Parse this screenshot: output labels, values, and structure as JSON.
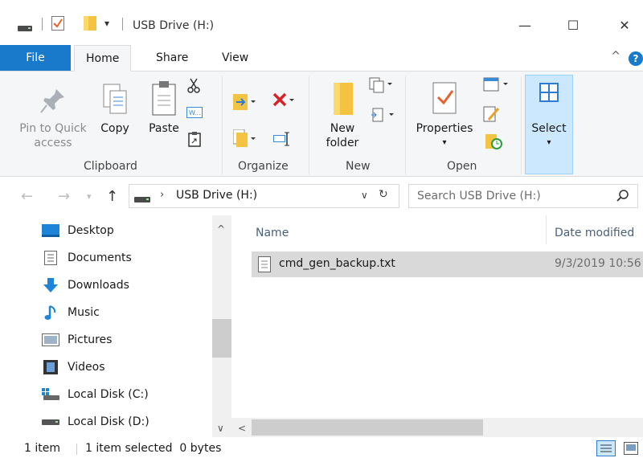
{
  "window": {
    "title": "USB Drive (H:)",
    "min_glyph": "—",
    "max_glyph": "☐",
    "close_glyph": "✕"
  },
  "ribbon_tabs": [
    "File",
    "Home",
    "Share",
    "View"
  ],
  "ribbon": {
    "clipboard": {
      "label": "Clipboard",
      "pin_label_1": "Pin to Quick",
      "pin_label_2": "access",
      "copy": "Copy",
      "paste": "Paste"
    },
    "organize": {
      "label": "Organize"
    },
    "new": {
      "label": "New",
      "new_folder_1": "New",
      "new_folder_2": "folder"
    },
    "open": {
      "label": "Open",
      "properties": "Properties"
    },
    "select": {
      "label": "Select"
    }
  },
  "address": {
    "path": "USB Drive (H:)",
    "search_placeholder": "Search USB Drive (H:)"
  },
  "nav_items": [
    {
      "label": "Desktop",
      "icon": "desktop-icon"
    },
    {
      "label": "Documents",
      "icon": "documents-icon"
    },
    {
      "label": "Downloads",
      "icon": "downloads-icon"
    },
    {
      "label": "Music",
      "icon": "music-icon"
    },
    {
      "label": "Pictures",
      "icon": "pictures-icon"
    },
    {
      "label": "Videos",
      "icon": "videos-icon"
    },
    {
      "label": "Local Disk (C:)",
      "icon": "local-disk-c-icon"
    },
    {
      "label": "Local Disk (D:)",
      "icon": "local-disk-d-icon"
    }
  ],
  "columns": {
    "name": "Name",
    "date": "Date modified"
  },
  "files": [
    {
      "name": "cmd_gen_backup.txt",
      "date": "9/3/2019 10:56"
    }
  ],
  "status": {
    "count": "1 item",
    "selection": "1 item selected  0 bytes"
  },
  "colors": {
    "accent": "#1979ca",
    "selection": "#d9d9d9",
    "select_highlight": "#cce8ff"
  }
}
